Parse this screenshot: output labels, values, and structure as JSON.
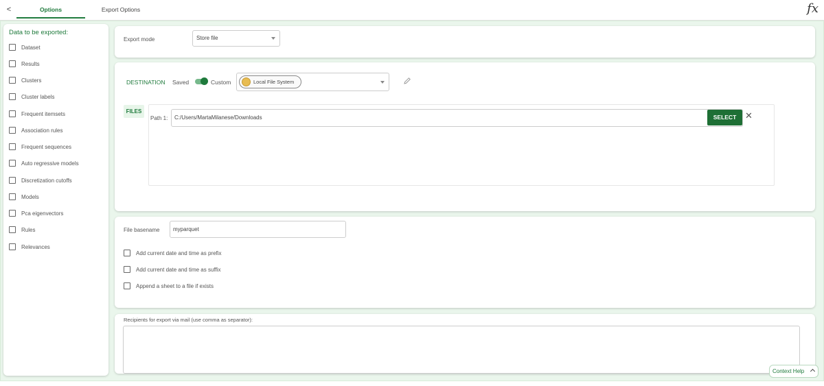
{
  "topbar": {
    "back_symbol": "<",
    "tabs": [
      {
        "label": "Options",
        "active": true
      },
      {
        "label": "Export Options",
        "active": false
      }
    ],
    "fx_symbol": "fx"
  },
  "left_panel": {
    "title": "Data to be exported:",
    "items": [
      {
        "label": "Dataset",
        "checked": false
      },
      {
        "label": "Results",
        "checked": false
      },
      {
        "label": "Clusters",
        "checked": false
      },
      {
        "label": "Cluster labels",
        "checked": false
      },
      {
        "label": "Frequent itemsets",
        "checked": false
      },
      {
        "label": "Association rules",
        "checked": false
      },
      {
        "label": "Frequent sequences",
        "checked": false
      },
      {
        "label": "Auto regressive models",
        "checked": false
      },
      {
        "label": "Discretization cutoffs",
        "checked": false
      },
      {
        "label": "Models",
        "checked": false
      },
      {
        "label": "Pca eigenvectors",
        "checked": false
      },
      {
        "label": "Rules",
        "checked": false
      },
      {
        "label": "Relevances",
        "checked": false
      }
    ]
  },
  "export_mode": {
    "label": "Export mode",
    "value": "Store file"
  },
  "destination": {
    "title": "DESTINATION",
    "saved_label": "Saved",
    "custom_label": "Custom",
    "storage": "Local File System",
    "files_label": "FILES",
    "path_label": "Path 1:",
    "path_value": "C:/Users/MartaMilanese/Downloads",
    "select_label": "SELECT",
    "close_symbol": "✕"
  },
  "basename": {
    "label": "File basename",
    "value": "myparquet",
    "options": [
      {
        "label": "Add current date and time as prefix",
        "checked": false
      },
      {
        "label": "Add current date and time as suffix",
        "checked": false
      },
      {
        "label": "Append a sheet to a file if exists",
        "checked": false
      }
    ]
  },
  "recipients": {
    "label": "Recipients for export via mail (use comma as separator):",
    "value": ""
  },
  "context_help": {
    "label": "Context Help"
  },
  "colors": {
    "accent": "#1f7a3c",
    "button": "#1e6f35",
    "background": "#eaf6ec"
  }
}
